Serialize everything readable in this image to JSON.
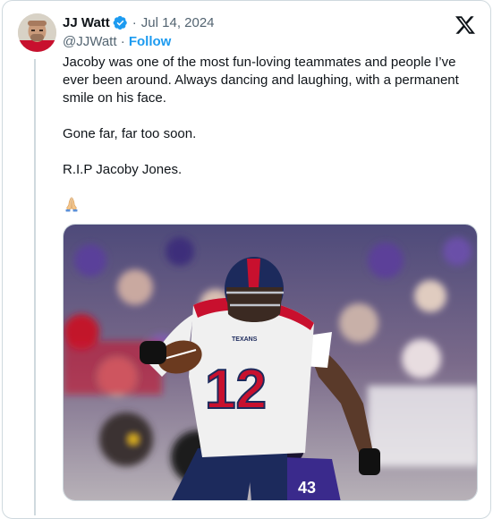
{
  "tweet": {
    "author_name": "JJ Watt",
    "handle": "@JJWatt",
    "separator": "·",
    "date": "Jul 14, 2024",
    "follow_label": "Follow",
    "paragraphs": [
      "Jacoby was one of the most fun-loving teammates and people I’ve ever been around. Always dancing and laughing, with a permanent smile on his face.",
      "Gone far, far too soon.",
      "R.I.P Jacoby Jones."
    ],
    "emoji": "praying-hands-emoji"
  },
  "photo": {
    "jersey_number": "12",
    "opponent_number": "43",
    "helmet_text": "TEXANS",
    "colors": {
      "home_blue": "#1c2a5c",
      "home_red": "#c8102e",
      "away_purple": "#3a2a8c",
      "verified_blue": "#1d9bf0"
    }
  },
  "icons": {
    "verified": "verified-badge-icon",
    "platform": "x-logo-icon"
  }
}
